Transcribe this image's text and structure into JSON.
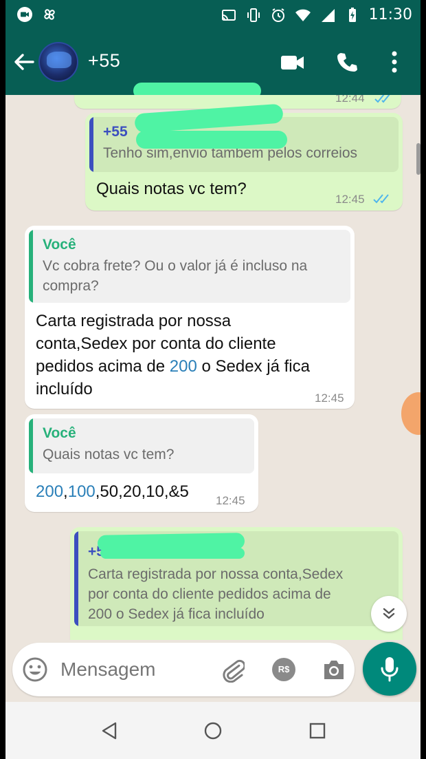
{
  "status_bar": {
    "time": "11:30"
  },
  "header": {
    "contact_name": "+55"
  },
  "messages": [
    {
      "direction": "out",
      "quote": {
        "author": "+55",
        "text": "Tenho sim,envio também pelos correios"
      },
      "text": "Quais notas vc tem?",
      "time": "12:45",
      "status": "read"
    },
    {
      "direction": "in",
      "quote": {
        "author": "Você",
        "text_lines": [
          "Vc cobra frete? Ou o valor já é incluso na",
          "compra?"
        ]
      },
      "text_lines": [
        "Carta registrada por nossa",
        "conta,Sedex por conta do cliente"
      ],
      "line3_before": "pedidos acima de ",
      "line3_number": "200",
      "line3_after": " o Sedex já fica",
      "line4": "incluído",
      "time": "12:45"
    },
    {
      "direction": "in",
      "quote": {
        "author": "Você",
        "text": "Quais notas vc tem?"
      },
      "text_num1": "200",
      "text_sep1": ",",
      "text_num2": "100",
      "text_rest": ",50,20,10,&5",
      "time": "12:45"
    },
    {
      "direction": "out",
      "quote": {
        "author": "+5",
        "text_lines": [
          "Carta registrada por nossa conta,Sedex",
          "por conta do cliente pedidos acima de",
          "200 o Sedex já fica incluído"
        ]
      }
    }
  ],
  "partial_prev_time": "12:44",
  "composer": {
    "placeholder": "Mensagem",
    "currency_label": "R$"
  },
  "colors": {
    "header": "#075e54",
    "outgoing_bubble": "#dcf8c6",
    "incoming_bubble": "#ffffff",
    "accent": "#00897b",
    "read_ticks": "#4fb6ec",
    "link_number": "#2a7fb8"
  },
  "icons": [
    "video-call-icon",
    "voice-call-icon",
    "more-options-icon",
    "back-arrow-icon",
    "emoji-icon",
    "attach-icon",
    "payment-icon",
    "camera-icon",
    "mic-icon",
    "scroll-down-icon"
  ]
}
